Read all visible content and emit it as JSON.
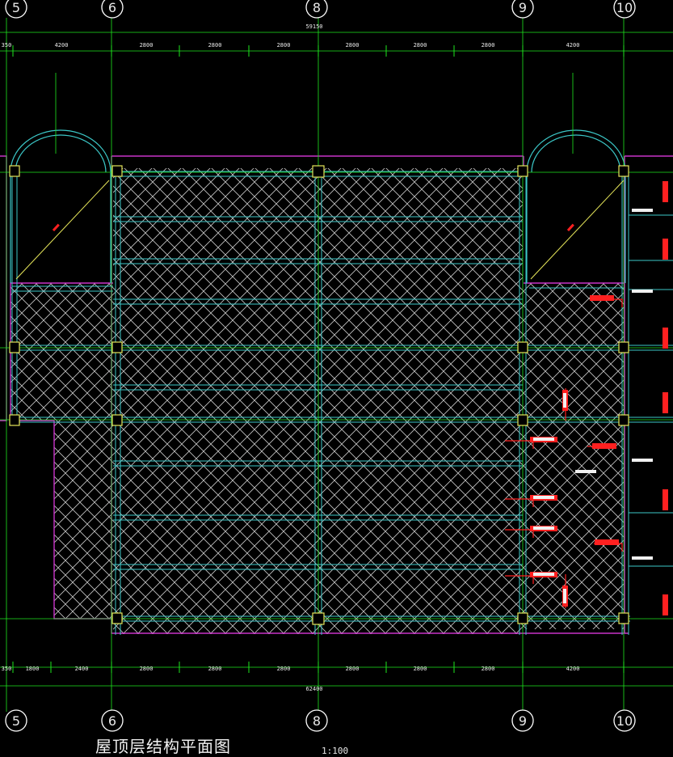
{
  "drawing": {
    "title": "屋顶层结构平面图",
    "scale": "1:100"
  },
  "axes": [
    "5",
    "6",
    "8",
    "9",
    "10"
  ],
  "dimensions": {
    "top_overall": "59150",
    "top_segments": [
      "350",
      "4200",
      "2800",
      "2800",
      "2800",
      "2800",
      "2800",
      "2800",
      "4200"
    ],
    "bottom_overall": "62400",
    "bottom_segments": [
      "350",
      "1800",
      "2400",
      "2800",
      "2800",
      "2800",
      "2800",
      "2800",
      "2800",
      "4200"
    ]
  },
  "colors": {
    "grid": "#1ee61e",
    "slab_outline": "#c832c8",
    "beam": "#3cc8c8",
    "hatch": "#c8c8c8",
    "rebar": "#ff2020",
    "annotation": "#ffffff"
  }
}
